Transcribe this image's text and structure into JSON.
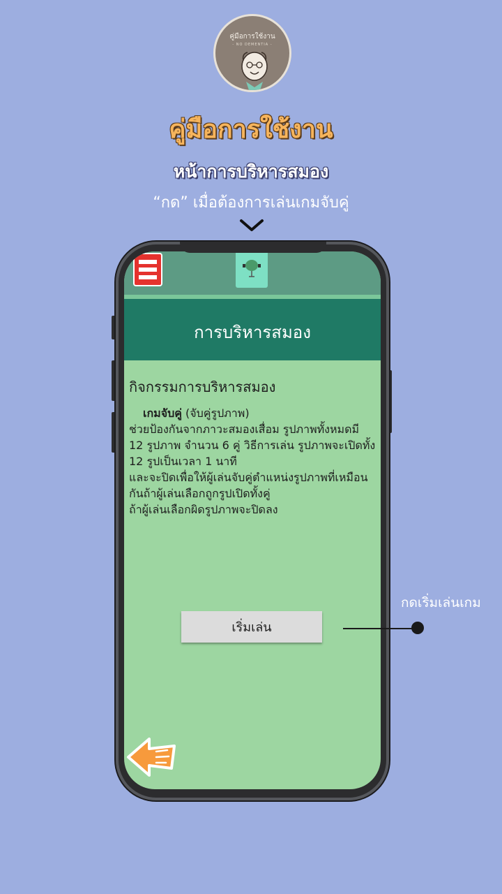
{
  "logo": {
    "title": "คู่มือการใช้งาน",
    "subtitle": "- NO DEMENTIA -"
  },
  "header": {
    "title": "คู่มือการใช้งาน",
    "subtitle": "หน้าการบริหารสมอง",
    "instruction": "“กด” เมื่อต้องการเล่นเกมจับคู่"
  },
  "app": {
    "icons": {
      "menu": "hamburger-menu-icon",
      "brain": "brain-exercise-icon",
      "back": "back-arrow-icon"
    },
    "page_title": "การบริหารสมอง",
    "section_heading": "กิจกรรมการบริหารสมอง",
    "game_name": "เกมจับคู่",
    "game_name_suffix": " (จับคู่รูปภาพ)",
    "description_lines": [
      "ช่วยป้องกันจากภาวะสมองเสื่อม รูปภาพทั้งหมดมี",
      "12 รูปภาพ จำนวน 6 คู่ วิธีการเล่น รูปภาพจะเปิดทั้ง",
      "12 รูปเป็นเวลา 1 นาที",
      "และจะปิดเพื่อให้ผู้เล่นจับคู่ตำแหน่งรูปภาพที่เหมือน",
      "กันถ้าผู้เล่นเลือกถูกรูปเปิดทั้งคู่",
      "ถ้าผู้เล่นเลือกผิดรูปภาพจะปิดลง"
    ],
    "start_button_label": "เริ่มเล่น"
  },
  "callout": {
    "label": "กดเริ่มเล่นเกม"
  },
  "colors": {
    "background": "#9daee0",
    "app_bar": "#5d9b84",
    "header_band": "#1f7a65",
    "screen_bg": "#9dd6a1",
    "menu_button": "#e5322e",
    "title_orange": "#f6b45c"
  }
}
